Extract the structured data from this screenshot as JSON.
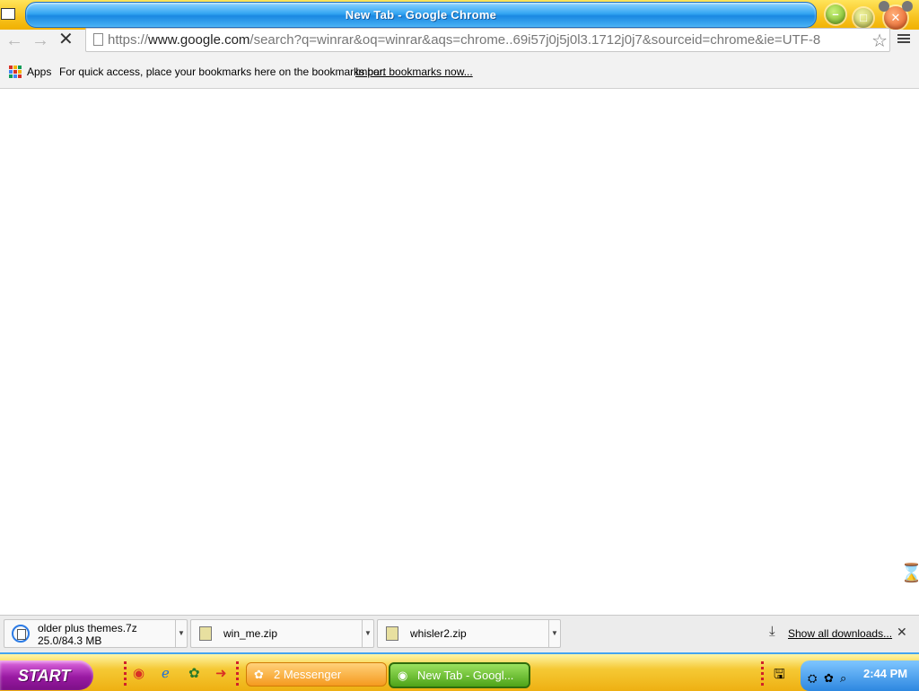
{
  "window": {
    "title": "New Tab - Google Chrome",
    "minimize_glyph": "–",
    "maximize_glyph": "□",
    "close_glyph": "✕"
  },
  "toolbar": {
    "back_glyph": "←",
    "forward_glyph": "→",
    "stop_glyph": "✕",
    "url_scheme": "https://",
    "url_domain": "www.google.com",
    "url_path": "/search?q=winrar&oq=winrar&aqs=chrome..69i57j0j5j0l3.1712j0j7&sourceid=chrome&ie=UTF-8",
    "star_glyph": "☆"
  },
  "bookmarks_bar": {
    "apps_label": "Apps",
    "hint": "For quick access, place your bookmarks here on the bookmarks bar.",
    "import_link": "Import bookmarks now..."
  },
  "content": {
    "busy_cursor_glyph": "⌛"
  },
  "downloads": {
    "items": [
      {
        "name": "older plus themes.7z",
        "status": "25.0/84.3 MB",
        "icon": "download-progress-icon"
      },
      {
        "name": "win_me.zip",
        "icon": "zip-file-icon"
      },
      {
        "name": "whisler2.zip",
        "icon": "zip-file-icon"
      }
    ],
    "show_all": "Show all downloads...",
    "show_all_glyph": "⤓",
    "close_glyph": "✕",
    "arrow_glyph": "▼"
  },
  "taskbar": {
    "start_label": "START",
    "quick_launch": [
      {
        "icon": "chrome-icon",
        "glyph": "◉",
        "color": "#d93025"
      },
      {
        "icon": "internet-explorer-icon",
        "glyph": "ℯ",
        "color": "#1e6fd9"
      },
      {
        "icon": "messenger-icon",
        "glyph": "✿",
        "color": "#2a7a2a"
      },
      {
        "icon": "arrow-icon",
        "glyph": "➜",
        "color": "#d93025"
      }
    ],
    "tasks": [
      {
        "label": "2 Messenger",
        "icon": "messenger-icon",
        "glyph": "✿"
      },
      {
        "label": "New Tab - Googl...",
        "icon": "chrome-icon",
        "glyph": "◉"
      }
    ],
    "tray_left_glyph": "🖫",
    "clock": "2:44 PM"
  },
  "colors": {
    "title_bar": "#34a6f2",
    "frame": "#f7c21e",
    "start_button": "#9a1aa3",
    "active_task": "#4da318",
    "tray": "#2d87e0"
  }
}
